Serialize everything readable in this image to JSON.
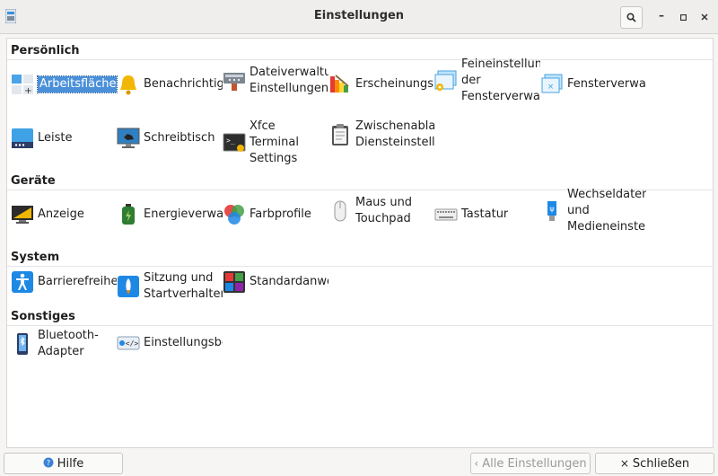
{
  "window": {
    "title": "Einstellungen"
  },
  "sections": {
    "personal": {
      "title": "Persönlich",
      "items": [
        {
          "label": "Arbeitsflächen",
          "icon": "workspaces-icon"
        },
        {
          "label": "Benachrichtigungen",
          "icon": "bell-icon"
        },
        {
          "label": "Dateiverwaltung\nEinstellungen",
          "icon": "file-manager-icon"
        },
        {
          "label": "Erscheinungsbild",
          "icon": "appearance-icon"
        },
        {
          "label": "Feineinstellungen\nder\nFensterverwaltung",
          "icon": "wm-tweaks-icon"
        },
        {
          "label": "Fensterverwaltung",
          "icon": "window-manager-icon"
        },
        {
          "label": "Leiste",
          "icon": "panel-icon"
        },
        {
          "label": "Schreibtisch",
          "icon": "desktop-icon"
        },
        {
          "label": "Xfce\nTerminal\nSettings",
          "icon": "terminal-icon"
        },
        {
          "label": "Zwischenablage\nDiensteinstellungen",
          "icon": "clipboard-icon"
        }
      ]
    },
    "hardware": {
      "title": "Geräte",
      "items": [
        {
          "label": "Anzeige",
          "icon": "display-icon"
        },
        {
          "label": "Energieverwaltung",
          "icon": "battery-icon"
        },
        {
          "label": "Farbprofile",
          "icon": "color-profiles-icon"
        },
        {
          "label": "Maus und\nTouchpad",
          "icon": "mouse-icon"
        },
        {
          "label": "Tastatur",
          "icon": "keyboard-icon"
        },
        {
          "label": "Wechseldaten\nund\nMedieneinstellungen",
          "icon": "usb-icon"
        }
      ]
    },
    "system": {
      "title": "System",
      "items": [
        {
          "label": "Barrierefreiheit",
          "icon": "accessibility-icon"
        },
        {
          "label": "Sitzung und\nStartverhalten",
          "icon": "rocket-icon"
        },
        {
          "label": "Standardanwendungen",
          "icon": "default-apps-icon"
        }
      ]
    },
    "other": {
      "title": "Sonstiges",
      "items": [
        {
          "label": "Bluetooth-\nAdapter",
          "icon": "bluetooth-icon"
        },
        {
          "label": "Einstellungsbearbeitung",
          "icon": "settings-editor-icon"
        }
      ]
    }
  },
  "buttons": {
    "help": "Hilfe",
    "all_settings": "Alle Einstellungen",
    "close": "Schließen"
  }
}
